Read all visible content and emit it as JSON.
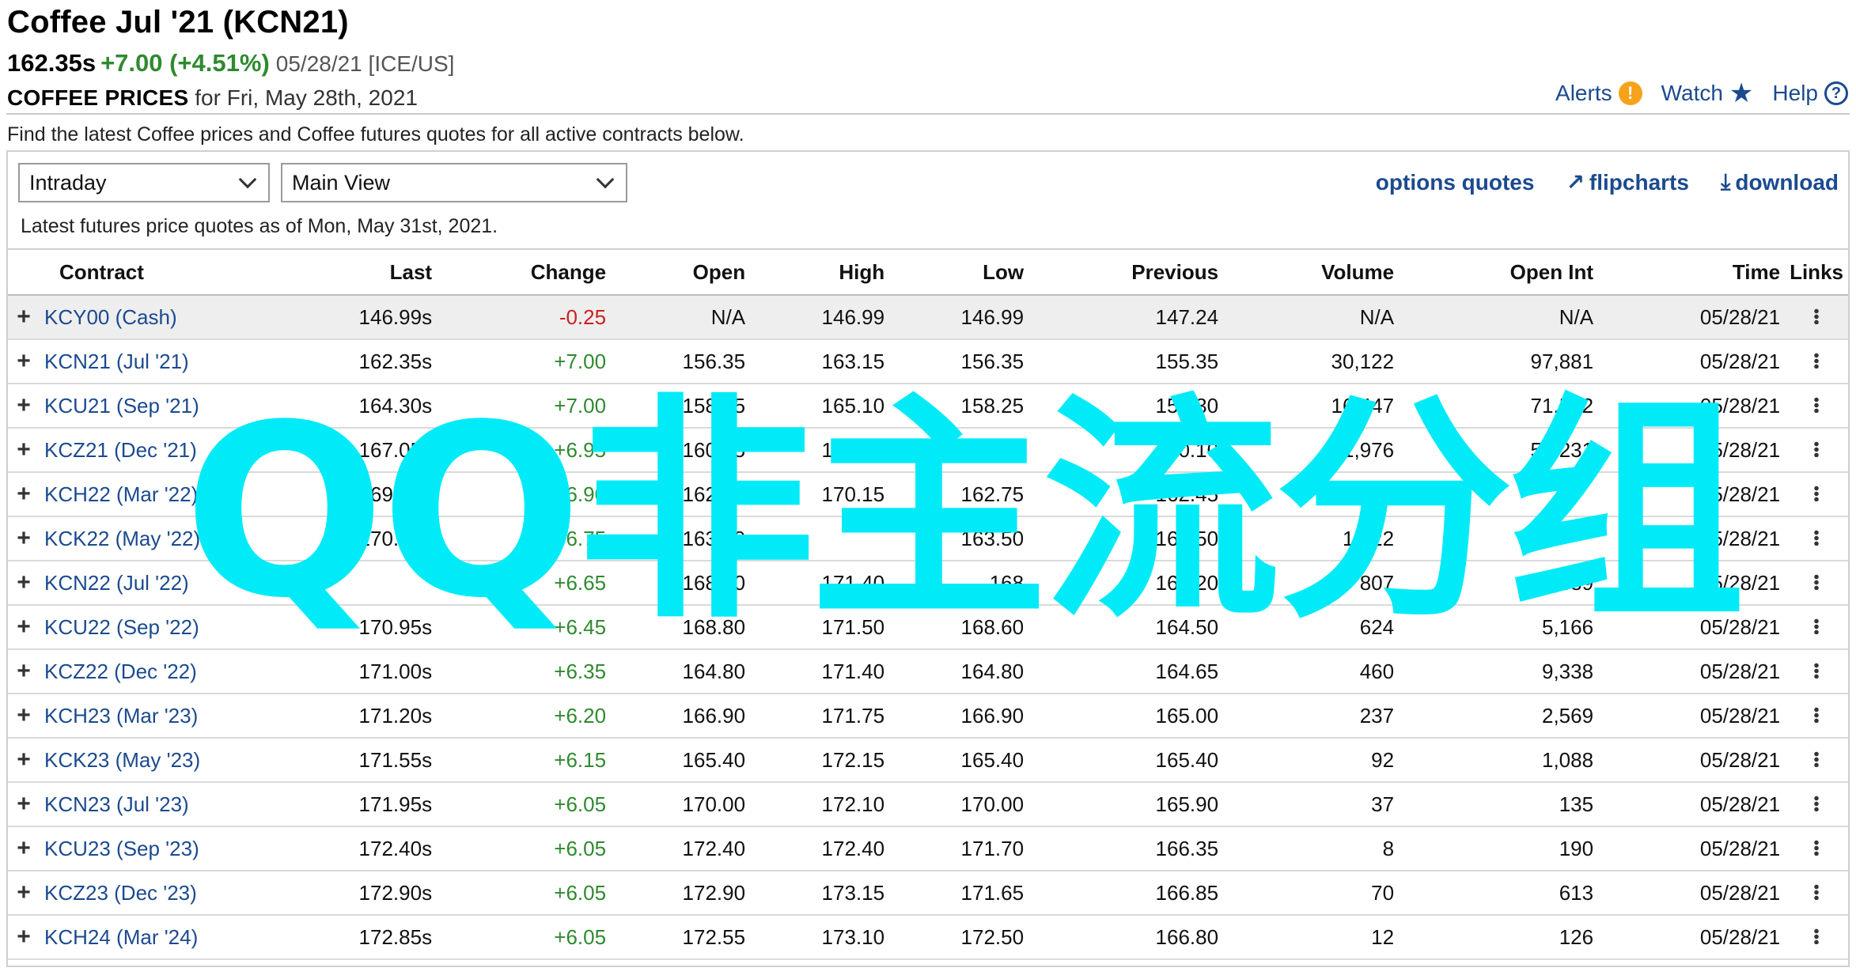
{
  "header": {
    "title": "Coffee Jul '21 (KCN21)",
    "last": "162.35s",
    "change": "+7.00 (+4.51%)",
    "meta": "05/28/21 [ICE/US]",
    "sub_label": "COFFEE PRICES",
    "sub_date": "for Fri, May 28th, 2021"
  },
  "actions": {
    "alerts": "Alerts",
    "watch": "Watch",
    "help": "Help"
  },
  "intro": "Find the latest Coffee prices and Coffee futures quotes for all active contracts below.",
  "selects": {
    "period": "Intraday",
    "view": "Main View"
  },
  "tools": {
    "options": "options quotes",
    "flipcharts": "flipcharts",
    "download": "download"
  },
  "asof": "Latest futures price quotes as of Mon, May 31st, 2021.",
  "table": {
    "headers": [
      "Contract",
      "Last",
      "Change",
      "Open",
      "High",
      "Low",
      "Previous",
      "Volume",
      "Open Int",
      "Time",
      "Links"
    ],
    "rows": [
      {
        "contract": "KCY00 (Cash)",
        "last": "146.99s",
        "change": "-0.25",
        "open": "N/A",
        "high": "146.99",
        "low": "146.99",
        "prev": "147.24",
        "vol": "N/A",
        "oi": "N/A",
        "time": "05/28/21"
      },
      {
        "contract": "KCN21 (Jul '21)",
        "last": "162.35s",
        "change": "+7.00",
        "open": "156.35",
        "high": "163.15",
        "low": "156.35",
        "prev": "155.35",
        "vol": "30,122",
        "oi": "97,881",
        "time": "05/28/21"
      },
      {
        "contract": "KCU21 (Sep '21)",
        "last": "164.30s",
        "change": "+7.00",
        "open": "158.25",
        "high": "165.10",
        "low": "158.25",
        "prev": "157.30",
        "vol": "16,447",
        "oi": "71,562",
        "time": "05/28/21"
      },
      {
        "contract": "KCZ21 (Dec '21)",
        "last": "167.05s",
        "change": "+6.95",
        "open": "160.75",
        "high": "167.75",
        "low": "160.75",
        "prev": "160.10",
        "vol": "11,976",
        "oi": "52,231",
        "time": "05/28/21"
      },
      {
        "contract": "KCH22 (Mar '22)",
        "last": "169.35s",
        "change": "+6.90",
        "open": "162.75",
        "high": "170.15",
        "low": "162.75",
        "prev": "162.45",
        "vol": "6,4",
        "oi": "",
        "time": "05/28/21"
      },
      {
        "contract": "KCK22 (May '22)",
        "last": "170.25s",
        "change": "+6.75",
        "open": "163.50",
        "high": "",
        "low": "163.50",
        "prev": "163.50",
        "vol": "1,722",
        "oi": "",
        "time": "05/28/21"
      },
      {
        "contract": "KCN22 (Jul '22)",
        "last": "",
        "change": "+6.65",
        "open": "168.00",
        "high": "171.40",
        "low": "168",
        "prev": "164.20",
        "vol": "807",
        "oi": "4,889",
        "time": "05/28/21"
      },
      {
        "contract": "KCU22 (Sep '22)",
        "last": "170.95s",
        "change": "+6.45",
        "open": "168.80",
        "high": "171.50",
        "low": "168.60",
        "prev": "164.50",
        "vol": "624",
        "oi": "5,166",
        "time": "05/28/21"
      },
      {
        "contract": "KCZ22 (Dec '22)",
        "last": "171.00s",
        "change": "+6.35",
        "open": "164.80",
        "high": "171.40",
        "low": "164.80",
        "prev": "164.65",
        "vol": "460",
        "oi": "9,338",
        "time": "05/28/21"
      },
      {
        "contract": "KCH23 (Mar '23)",
        "last": "171.20s",
        "change": "+6.20",
        "open": "166.90",
        "high": "171.75",
        "low": "166.90",
        "prev": "165.00",
        "vol": "237",
        "oi": "2,569",
        "time": "05/28/21"
      },
      {
        "contract": "KCK23 (May '23)",
        "last": "171.55s",
        "change": "+6.15",
        "open": "165.40",
        "high": "172.15",
        "low": "165.40",
        "prev": "165.40",
        "vol": "92",
        "oi": "1,088",
        "time": "05/28/21"
      },
      {
        "contract": "KCN23 (Jul '23)",
        "last": "171.95s",
        "change": "+6.05",
        "open": "170.00",
        "high": "172.10",
        "low": "170.00",
        "prev": "165.90",
        "vol": "37",
        "oi": "135",
        "time": "05/28/21"
      },
      {
        "contract": "KCU23 (Sep '23)",
        "last": "172.40s",
        "change": "+6.05",
        "open": "172.40",
        "high": "172.40",
        "low": "171.70",
        "prev": "166.35",
        "vol": "8",
        "oi": "190",
        "time": "05/28/21"
      },
      {
        "contract": "KCZ23 (Dec '23)",
        "last": "172.90s",
        "change": "+6.05",
        "open": "172.90",
        "high": "173.15",
        "low": "171.65",
        "prev": "166.85",
        "vol": "70",
        "oi": "613",
        "time": "05/28/21"
      },
      {
        "contract": "KCH24 (Mar '24)",
        "last": "172.85s",
        "change": "+6.05",
        "open": "172.55",
        "high": "173.10",
        "low": "172.50",
        "prev": "166.80",
        "vol": "12",
        "oi": "126",
        "time": "05/28/21"
      }
    ]
  },
  "watermark": "QQ非主流分组",
  "colors": {
    "link": "#1b4a8f",
    "up": "#2f8a2f",
    "down": "#cc1f1f",
    "watermark": "#00ebf7",
    "alert": "#f7a21b"
  }
}
